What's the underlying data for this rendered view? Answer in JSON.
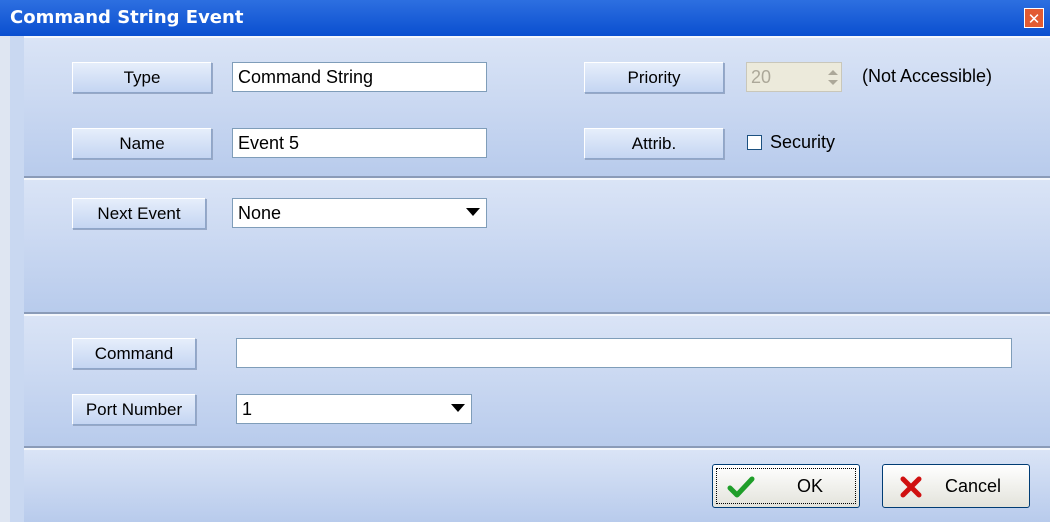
{
  "window": {
    "title": "Command String Event",
    "close_icon": "close-icon"
  },
  "general": {
    "type_label": "Type",
    "type_value": "Command String",
    "name_label": "Name",
    "name_value": "Event 5",
    "priority_label": "Priority",
    "priority_value": "20",
    "priority_note": "(Not Accessible)",
    "attrib_label": "Attrib.",
    "security_label": "Security",
    "security_checked": false
  },
  "flow": {
    "next_event_label": "Next Event",
    "next_event_value": "None"
  },
  "command": {
    "command_label": "Command",
    "command_value": "",
    "port_label": "Port Number",
    "port_value": "1"
  },
  "buttons": {
    "ok_label": "OK",
    "ok_icon": "checkmark-icon",
    "cancel_label": "Cancel",
    "cancel_icon": "x-icon"
  },
  "colors": {
    "title_bar": "#0a4fd0",
    "panel": "#c9d8f1",
    "ok_check": "#1f9e2a",
    "cancel_x": "#d01010"
  }
}
